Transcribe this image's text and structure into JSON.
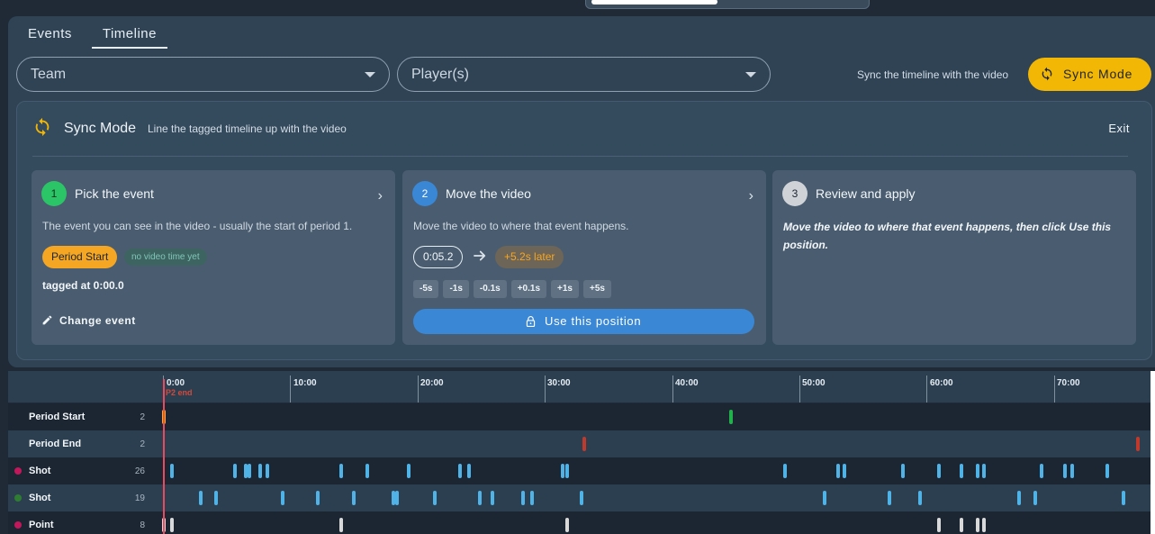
{
  "tabs": [
    {
      "label": "Events",
      "active": false
    },
    {
      "label": "Timeline",
      "active": true
    }
  ],
  "filters": {
    "team": {
      "label": "Team"
    },
    "players": {
      "label": "Player(s)"
    }
  },
  "sync_hint": "Sync the timeline with the video",
  "sync_button": {
    "label": "Sync Mode",
    "color": "#f2b705"
  },
  "sync_card": {
    "title": "Sync Mode",
    "subtitle": "Line the tagged timeline up with the video",
    "exit_label": "Exit",
    "steps": [
      {
        "number": "1",
        "title": "Pick the event",
        "description": "The event you can see in the video - usually the start of period 1.",
        "event_badge": "Period Start",
        "status_badge": "no video time yet",
        "tagged_at": "tagged at 0:00.0",
        "change_label": "Change event",
        "number_color": "#2bc466"
      },
      {
        "number": "2",
        "title": "Move the video",
        "description": "Move the video to where that event happens.",
        "video_time": "0:05.2",
        "offset": "+5.2s later",
        "nudges": [
          "-5s",
          "-1s",
          "-0.1s",
          "+0.1s",
          "+1s",
          "+5s"
        ],
        "use_label": "Use this position",
        "number_color": "#3a87d6"
      },
      {
        "number": "3",
        "title": "Review and apply",
        "description": "Move the video to where that event happens, then click Use this position.",
        "number_color": "#cfd3d7"
      }
    ]
  },
  "timeline": {
    "time_labels": [
      "0:00",
      "10:00",
      "20:00",
      "30:00",
      "40:00",
      "50:00",
      "60:00",
      "70:00"
    ],
    "marker_label": "P2 end",
    "rows": [
      {
        "label": "Period Start",
        "count": "2",
        "dot_color": null,
        "mark_color": "#21b24b"
      },
      {
        "label": "Period End",
        "count": "2",
        "dot_color": null,
        "mark_color": "#c0392b"
      },
      {
        "label": "Shot",
        "count": "26",
        "dot_color": "#c2185b",
        "mark_color": "#4fb3e8"
      },
      {
        "label": "Shot",
        "count": "19",
        "dot_color": "#2e7d32",
        "mark_color": "#4fb3e8"
      },
      {
        "label": "Point",
        "count": "8",
        "dot_color": "#c2185b",
        "mark_color": "#d9d9d9"
      }
    ]
  },
  "colors": {
    "accent": "#f2b705",
    "primary": "#3a87d6",
    "playhead": "#e84a5f",
    "panel": "#2f4355"
  }
}
